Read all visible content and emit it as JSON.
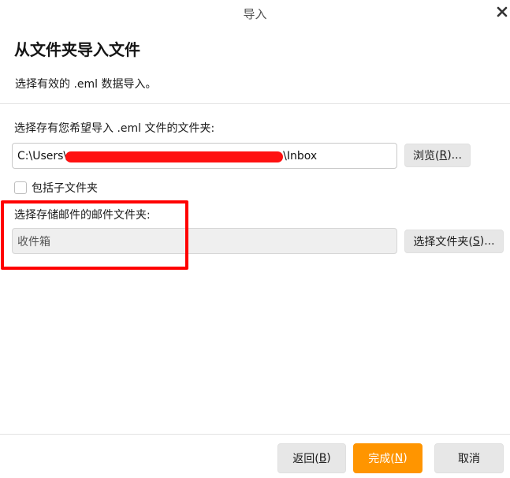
{
  "window": {
    "title": "导入",
    "close_icon": "close-icon"
  },
  "heading": "从文件夹导入文件",
  "subheading": "选择有效的 .eml 数据导入。",
  "source": {
    "label": "选择存有您希望导入 .eml 文件的文件夹:",
    "path_prefix": "C:\\Users\\",
    "path_suffix": "\\Inbox",
    "redaction_color": "#ff1010",
    "browse_label": "浏览(",
    "browse_key": "R",
    "browse_suffix": ")..."
  },
  "include_subfolders": {
    "label": "包括子文件夹",
    "checked": false
  },
  "destination": {
    "label": "选择存储邮件的邮件文件夹:",
    "value": "收件箱",
    "select_label": "选择文件夹(",
    "select_key": "S",
    "select_suffix": ")..."
  },
  "annotation": {
    "color": "#ff0000"
  },
  "footer": {
    "back_label": "返回(",
    "back_key": "B",
    "back_suffix": ")",
    "finish_label": "完成(",
    "finish_key": "N",
    "finish_suffix": ")",
    "cancel_label": "取消"
  },
  "colors": {
    "accent": "#ff9500",
    "button_bg": "#e7e7e7",
    "readonly_bg": "#efefef"
  }
}
